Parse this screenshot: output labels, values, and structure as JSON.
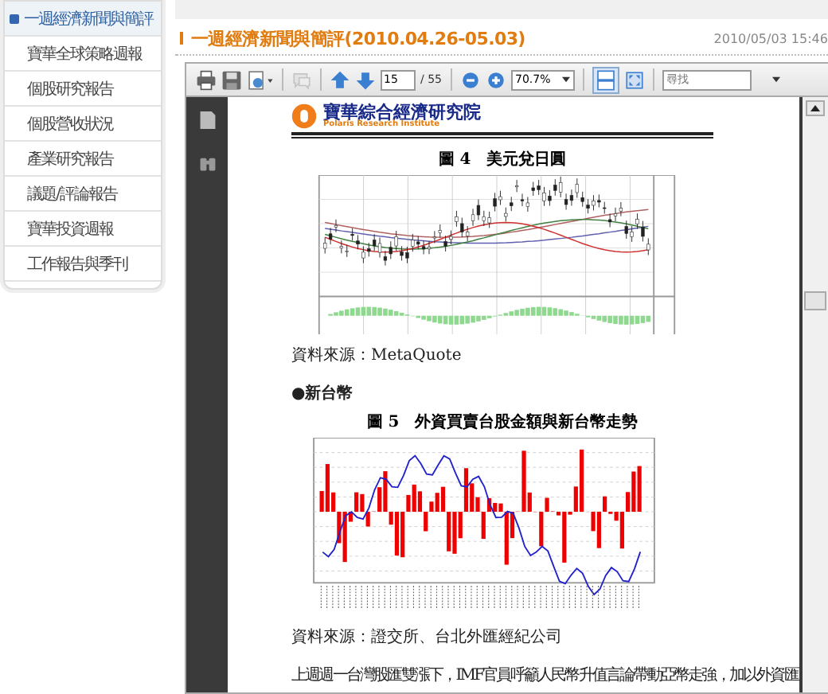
{
  "sidebar": {
    "items": [
      {
        "label": "一週經濟新聞與簡評",
        "selected": true
      },
      {
        "label": "寶華全球策略週報",
        "selected": false
      },
      {
        "label": "個股研究報告",
        "selected": false
      },
      {
        "label": "個股營收狀況",
        "selected": false
      },
      {
        "label": "產業研究報告",
        "selected": false
      },
      {
        "label": "議題/評論報告",
        "selected": false
      },
      {
        "label": "寶華投資週報",
        "selected": false
      },
      {
        "label": "工作報告與季刊",
        "selected": false
      }
    ]
  },
  "article": {
    "title": "一週經濟新聞與簡評(2010.04.26-05.03)",
    "date": "2010/05/03 15:46"
  },
  "viewer": {
    "toolbar": {
      "page": "15",
      "page_count": "/ 55",
      "zoom": "70.7%",
      "search_placeholder": "尋找",
      "fit_page": {
        "selected": true
      }
    },
    "document": {
      "logo_title": "寶華綜合經濟研究院",
      "logo_subtitle": "Polaris Research Institute",
      "figure_4_caption": "圖 4　美元兌日圓",
      "source_1": "資料來源：MetaQuote",
      "section_heading": "●新台幣",
      "figure_5_caption": "圖 5　外資買賣台股金額與新台幣走勢",
      "source_2": "資料來源：證交所、台北外匯經紀公司",
      "paragraph": "上週週一台灣股匯雙漲下，IMF官員呼籲人民幣升值言論帶動亞幣走強，加以外資匯"
    }
  }
}
